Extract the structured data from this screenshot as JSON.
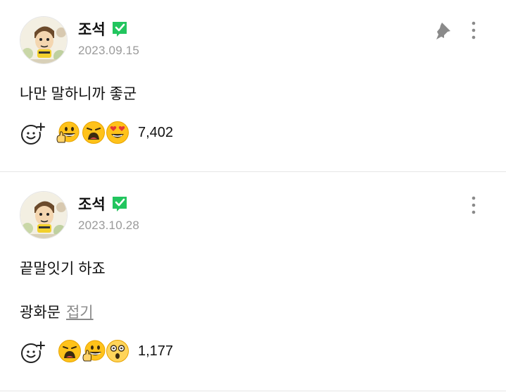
{
  "posts": [
    {
      "author": "조석",
      "date": "2023.09.15",
      "text": "나만 말하니까 좋군",
      "pinned": true,
      "reaction_count": "7,402",
      "reactions": [
        "thumbs-up-grin-emoji",
        "shocked-emoji",
        "heart-eyes-emoji"
      ]
    },
    {
      "author": "조석",
      "date": "2023.10.28",
      "text": "끝말잇기 하죠",
      "text2": "광화문",
      "fold_label": "접기",
      "pinned": false,
      "reaction_count": "1,177",
      "reactions": [
        "shocked-emoji",
        "thumbs-up-grin-emoji",
        "surprised-emoji"
      ]
    }
  ],
  "colors": {
    "badge": "#22c55e",
    "emoji": "#ffc21a",
    "divider": "#e6e6e6"
  }
}
